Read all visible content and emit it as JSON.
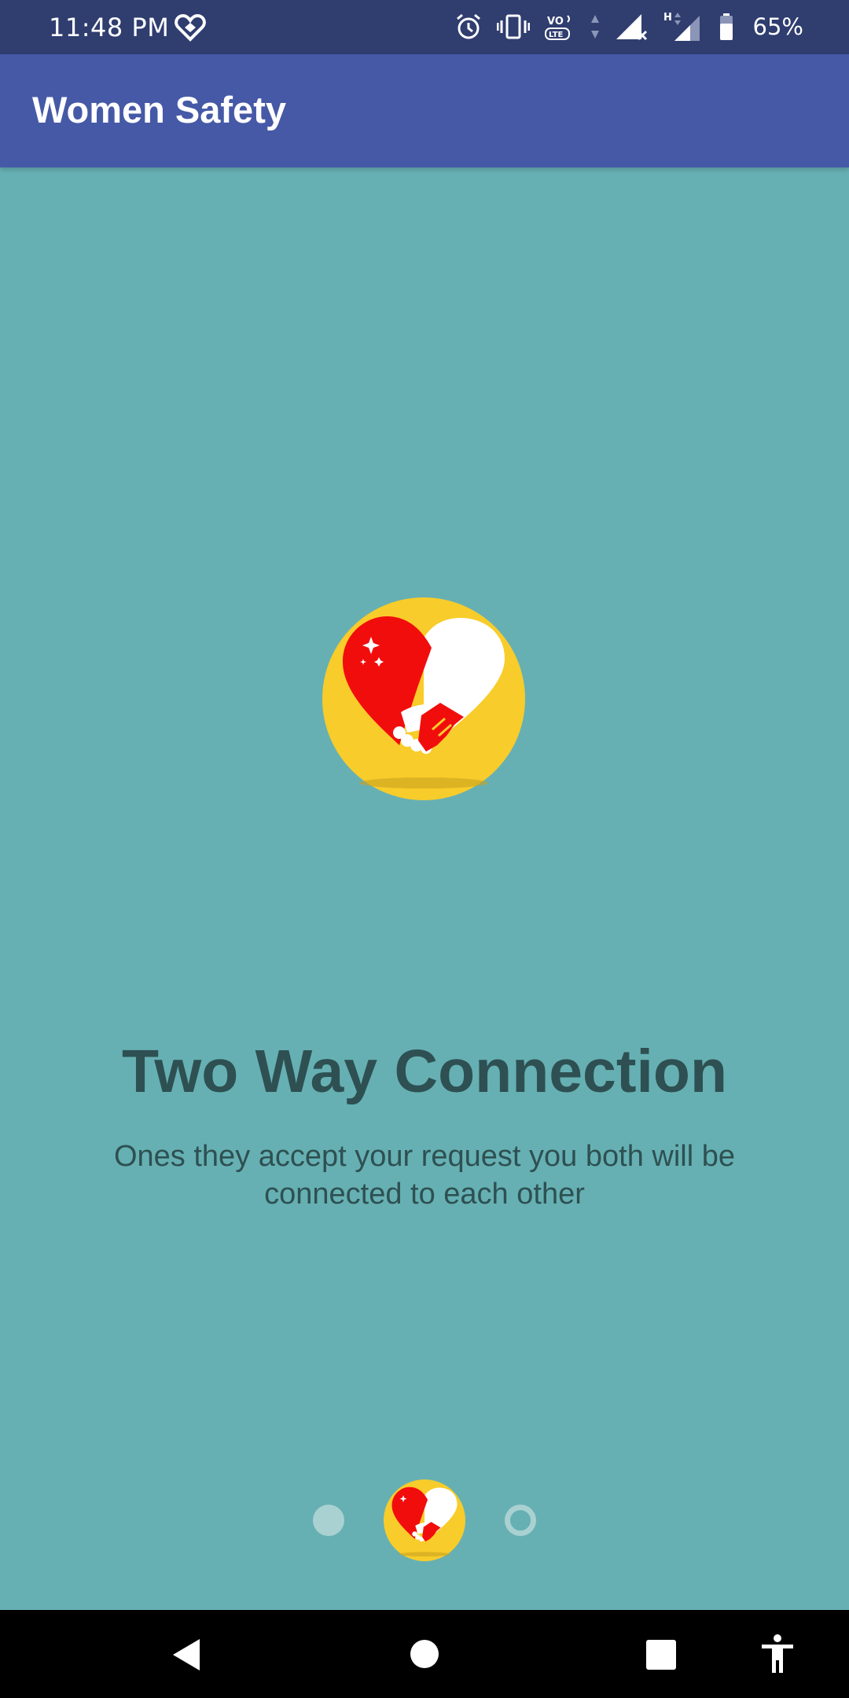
{
  "status_bar": {
    "time": "11:48 PM",
    "battery_percent": "65%",
    "icons": [
      "heart-app-icon",
      "alarm-icon",
      "vibrate-icon",
      "volte-icon",
      "signal-icon",
      "h-network-icon",
      "battery-icon"
    ]
  },
  "app_bar": {
    "title": "Women Safety"
  },
  "slide": {
    "icon": "handshake-heart-icon",
    "title": "Two Way Connection",
    "description": "Ones they accept your request you both will be connected to each other"
  },
  "pager": {
    "total_pages": 3,
    "current_page": 2
  },
  "colors": {
    "background": "#66b0b3",
    "status_bar": "#2f3d6f",
    "app_bar": "#4659a7",
    "text_dark": "#2e5052",
    "icon_yellow": "#f8cc2a",
    "icon_red": "#f20d0d",
    "indicator": "#a9d1d2"
  },
  "nav_bar": {
    "icons": [
      "back-icon",
      "home-icon",
      "recents-icon",
      "accessibility-icon"
    ]
  }
}
